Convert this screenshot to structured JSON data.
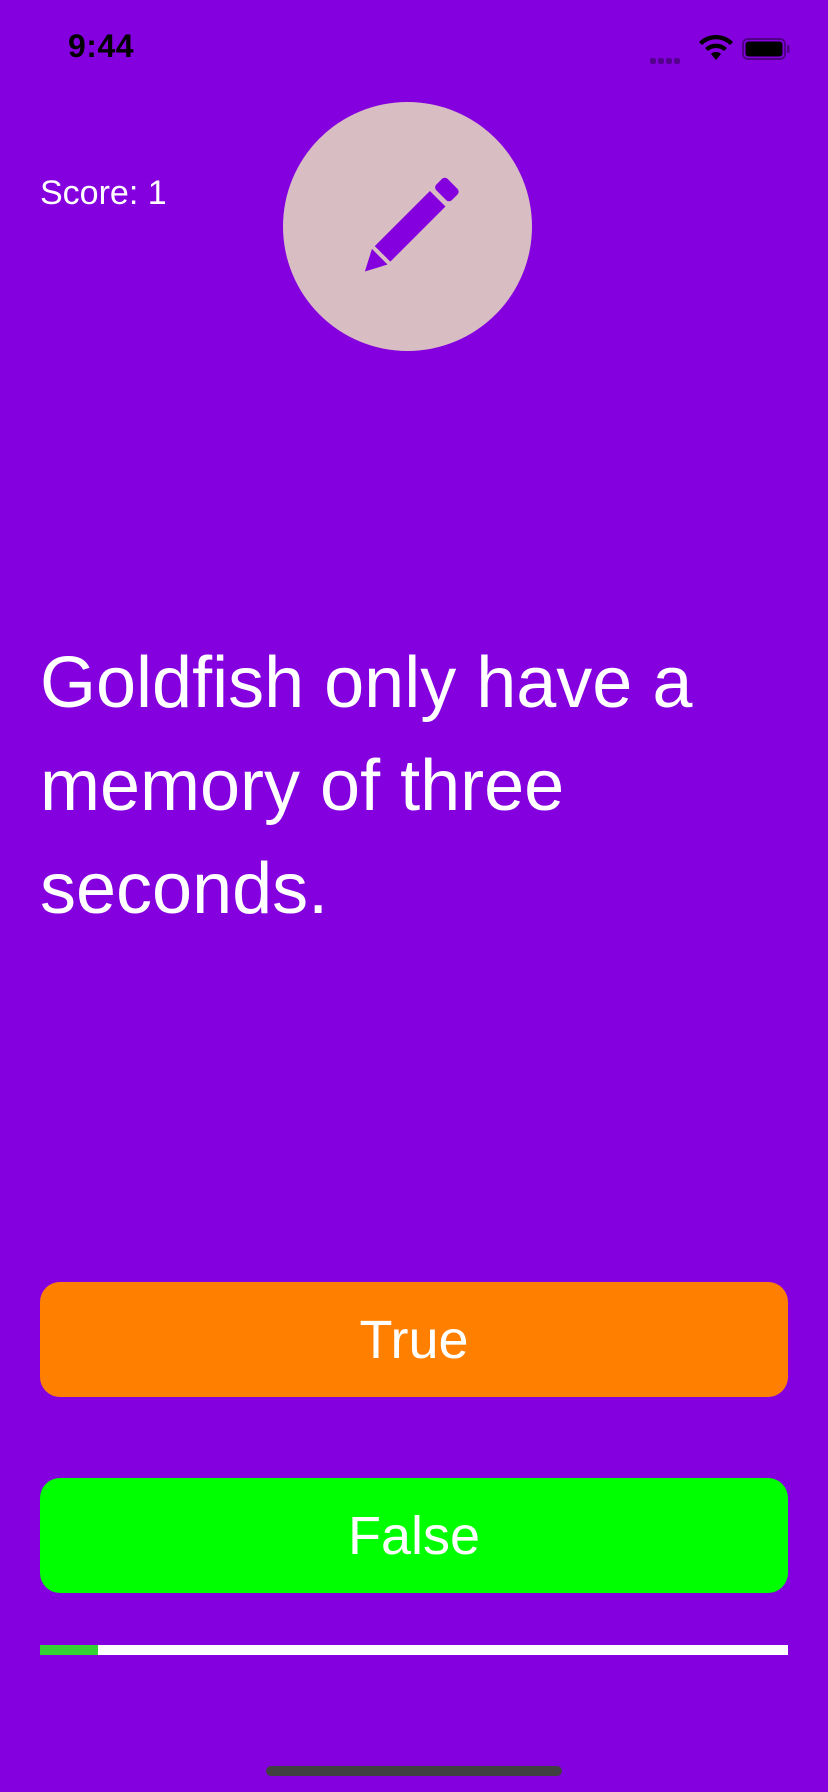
{
  "status_bar": {
    "time": "9:44",
    "icons": [
      "cellular-signal-icon",
      "wifi-icon",
      "battery-icon"
    ]
  },
  "header": {
    "score_label": "Score: 1",
    "avatar_icon": "pencil-icon"
  },
  "question": {
    "text": "Goldfish only have a memory of three seconds."
  },
  "answers": {
    "true_label": "True",
    "false_label": "False"
  },
  "progress": {
    "fraction": 0.077
  },
  "colors": {
    "background": "#8500DF",
    "avatar_circle": "#D8BDC3",
    "true_button": "#FF8000",
    "false_button": "#00FF00",
    "progress_track": "#FFFFFF",
    "progress_fill": "#35D234",
    "icon_tint": "#8500DF"
  }
}
